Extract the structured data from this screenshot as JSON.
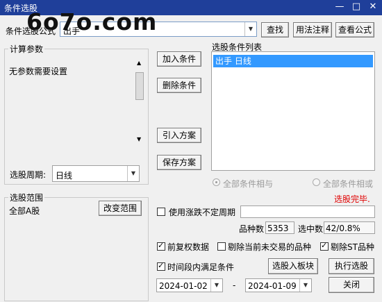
{
  "window": {
    "title": "条件选股"
  },
  "top": {
    "condition_label": "条件选股公式",
    "condition_value": "出手",
    "find_button": "查找",
    "usage_button": "用法注释",
    "view_formula_button": "查看公式"
  },
  "params": {
    "group_title": "计算参数",
    "message": "无参数需要设置",
    "period_label": "选股周期:",
    "period_value": "日线"
  },
  "middle_buttons": {
    "add_condition": "加入条件",
    "delete_condition": "删除条件",
    "import_scheme": "引入方案",
    "save_scheme": "保存方案"
  },
  "conditions": {
    "list_title": "选股条件列表",
    "items": [
      "出手  日线"
    ]
  },
  "logic": {
    "and_label": "全部条件相与",
    "or_label": "全部条件相或"
  },
  "status": {
    "text": "选股完毕.",
    "color": "#e00000"
  },
  "scope": {
    "group_title": "选股范围",
    "value": "全部A股",
    "change_button": "改变范围"
  },
  "options": {
    "use_variable_period_label": "使用涨跌不定周期",
    "use_variable_period_checked": false,
    "stock_count_label": "品种数",
    "stock_count_value": "5353",
    "selected_label": "选中数",
    "selected_value": "42/0.8%",
    "forward_adjust_label": "前复权数据",
    "forward_adjust_checked": true,
    "exclude_untraded_label": "剔除当前未交易的品种",
    "exclude_untraded_checked": false,
    "exclude_st_label": "剔除ST品种",
    "exclude_st_checked": true,
    "period_condition_label": "时间段内满足条件",
    "period_condition_checked": true
  },
  "actions": {
    "to_block_button": "选股入板块",
    "execute_button": "执行选股",
    "close_button": "关闭"
  },
  "dates": {
    "start": "2024-01-02",
    "separator": "-",
    "end": "2024-01-09"
  },
  "watermark": "6o7o.com"
}
